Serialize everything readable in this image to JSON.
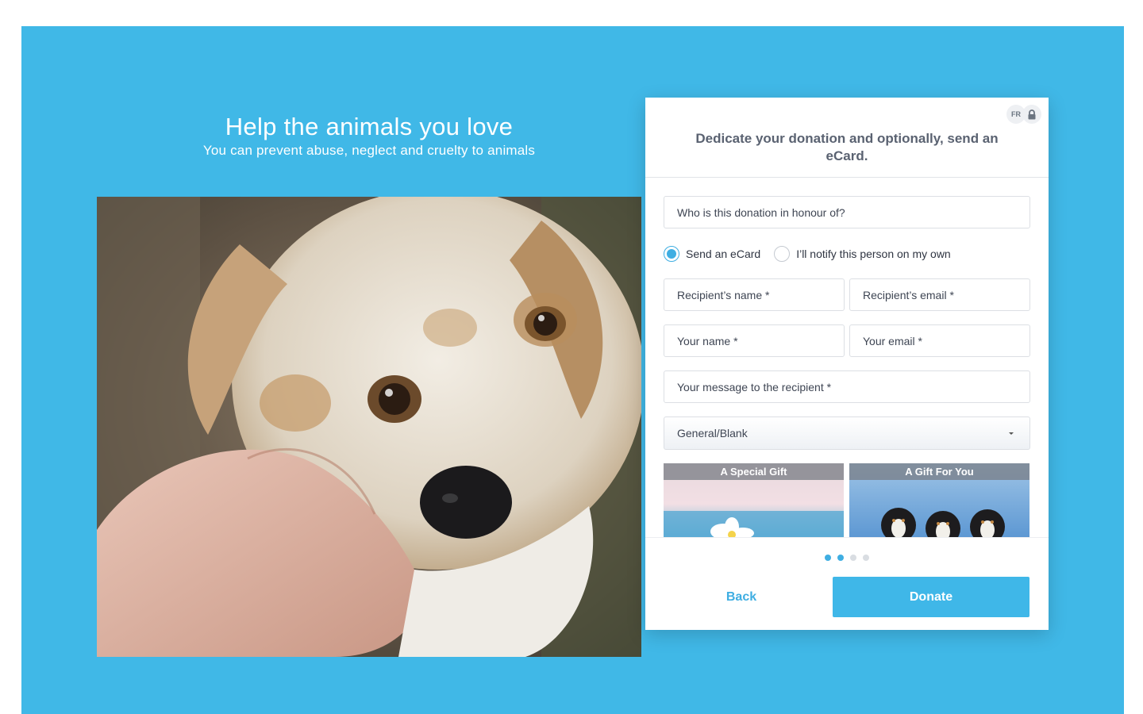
{
  "hero": {
    "title": "Help the animals you love",
    "subtitle": "You can prevent abuse, neglect and cruelty to animals"
  },
  "form": {
    "language_badge": "FR",
    "lock_icon": "lock-icon",
    "heading": "Dedicate your donation and optionally, send an eCard.",
    "honour_placeholder": "Who is this donation in honour of?",
    "radio_options": [
      {
        "label": "Send an eCard",
        "selected": true
      },
      {
        "label": "I’ll notify this person on my own",
        "selected": false
      }
    ],
    "recipient_name_placeholder": "Recipient’s name *",
    "recipient_email_placeholder": "Recipient’s email *",
    "your_name_placeholder": "Your name *",
    "your_email_placeholder": "Your email *",
    "message_placeholder": "Your message to the recipient *",
    "ecard_category": "General/Blank",
    "ecards": [
      {
        "label": "A Special Gift"
      },
      {
        "label": "A Gift For You"
      }
    ],
    "pager": {
      "total": 4,
      "active": [
        0,
        1
      ]
    },
    "back_label": "Back",
    "donate_label": "Donate"
  },
  "colors": {
    "background": "#40b8e7",
    "accent": "#3fb7e8",
    "heading_text": "#5a6271"
  }
}
